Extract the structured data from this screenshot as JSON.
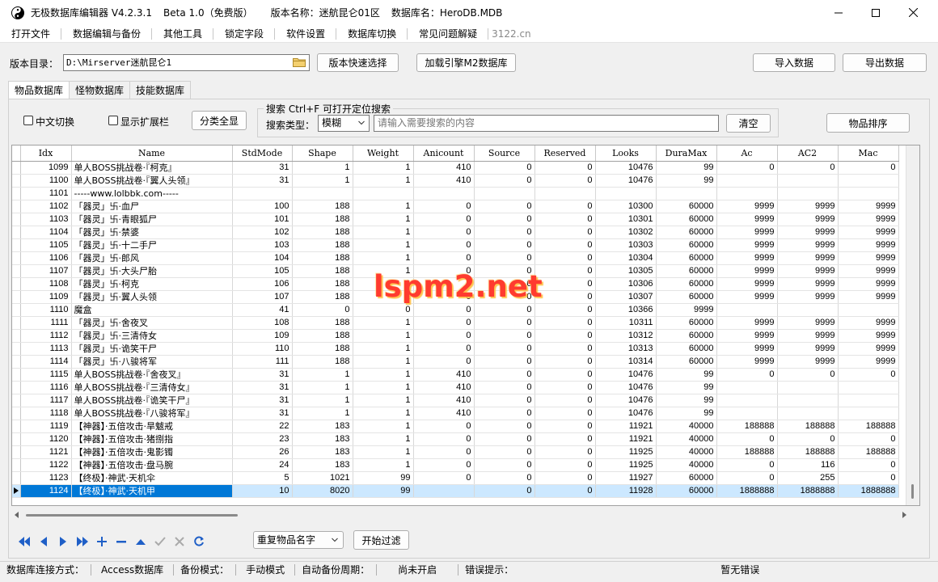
{
  "titlebar": {
    "app_name": "无极数据库编辑器 V4.2.3.1",
    "beta": "Beta 1.0（免费版）",
    "version_name": "版本名称：迷航昆仑01区",
    "database_name": "数据库名：HeroDB.MDB"
  },
  "menu": {
    "items": [
      "打开文件",
      "数据编辑与备份",
      "其他工具",
      "锁定字段",
      "软件设置",
      "数据库切换",
      "常见问题解疑"
    ],
    "site": "3122.cn"
  },
  "toolbar": {
    "dir_label": "版本目录：",
    "dir_value": "D:\\Mirserver迷航昆仑1",
    "quick_select": "版本快速选择",
    "load_engine": "加载引擎M2数据库",
    "import": "导入数据",
    "export": "导出数据"
  },
  "tabs": [
    "物品数据库",
    "怪物数据库",
    "技能数据库"
  ],
  "filters": {
    "chinese_toggle": "中文切换",
    "show_ext": "显示扩展栏",
    "show_all": "分类全显",
    "search_title": "搜索  Ctrl+F 可打开定位搜索",
    "search_type_label": "搜索类型：",
    "search_type_value": "模糊",
    "search_placeholder": "请输入需要搜索的内容",
    "clear": "清空",
    "sort": "物品排序"
  },
  "grid": {
    "columns": [
      "Idx",
      "Name",
      "StdMode",
      "Shape",
      "Weight",
      "Anicount",
      "Source",
      "Reserved",
      "Looks",
      "DuraMax",
      "Ac",
      "AC2",
      "Mac"
    ],
    "rows": [
      [
        "1099",
        "单人BOSS挑战卷·『柯克』",
        "31",
        "1",
        "1",
        "410",
        "0",
        "0",
        "10476",
        "99",
        "0",
        "0",
        "0"
      ],
      [
        "1100",
        "单人BOSS挑战卷·『翼人头领』",
        "31",
        "1",
        "1",
        "410",
        "0",
        "0",
        "10476",
        "99",
        "",
        "",
        ""
      ],
      [
        "1101",
        "-----www.lolbbk.com-----",
        "",
        "",
        "",
        "",
        "",
        "",
        "",
        "",
        "",
        "",
        ""
      ],
      [
        "1102",
        "「器灵」卐·血尸",
        "100",
        "188",
        "1",
        "0",
        "0",
        "0",
        "10300",
        "60000",
        "9999",
        "9999",
        "9999"
      ],
      [
        "1103",
        "「器灵」卐·青眼狐尸",
        "101",
        "188",
        "1",
        "0",
        "0",
        "0",
        "10301",
        "60000",
        "9999",
        "9999",
        "9999"
      ],
      [
        "1104",
        "「器灵」卐·禁婆",
        "102",
        "188",
        "1",
        "0",
        "0",
        "0",
        "10302",
        "60000",
        "9999",
        "9999",
        "9999"
      ],
      [
        "1105",
        "「器灵」卐·十二手尸",
        "103",
        "188",
        "1",
        "0",
        "0",
        "0",
        "10303",
        "60000",
        "9999",
        "9999",
        "9999"
      ],
      [
        "1106",
        "「器灵」卐·郎风",
        "104",
        "188",
        "1",
        "0",
        "0",
        "0",
        "10304",
        "60000",
        "9999",
        "9999",
        "9999"
      ],
      [
        "1107",
        "「器灵」卐·大头尸胎",
        "105",
        "188",
        "1",
        "0",
        "0",
        "0",
        "10305",
        "60000",
        "9999",
        "9999",
        "9999"
      ],
      [
        "1108",
        "「器灵」卐·柯克",
        "106",
        "188",
        "1",
        "0",
        "0",
        "0",
        "10306",
        "60000",
        "9999",
        "9999",
        "9999"
      ],
      [
        "1109",
        "「器灵」卐·翼人头领",
        "107",
        "188",
        "1",
        "0",
        "0",
        "0",
        "10307",
        "60000",
        "9999",
        "9999",
        "9999"
      ],
      [
        "1110",
        "魔盒",
        "41",
        "0",
        "0",
        "0",
        "0",
        "0",
        "10366",
        "9999",
        "",
        "",
        ""
      ],
      [
        "1111",
        "「器灵」卐·舍夜叉",
        "108",
        "188",
        "1",
        "0",
        "0",
        "0",
        "10311",
        "60000",
        "9999",
        "9999",
        "9999"
      ],
      [
        "1112",
        "「器灵」卐·三清侍女",
        "109",
        "188",
        "1",
        "0",
        "0",
        "0",
        "10312",
        "60000",
        "9999",
        "9999",
        "9999"
      ],
      [
        "1113",
        "「器灵」卐·诡笑干尸",
        "110",
        "188",
        "1",
        "0",
        "0",
        "0",
        "10313",
        "60000",
        "9999",
        "9999",
        "9999"
      ],
      [
        "1114",
        "「器灵」卐·八骏将军",
        "111",
        "188",
        "1",
        "0",
        "0",
        "0",
        "10314",
        "60000",
        "9999",
        "9999",
        "9999"
      ],
      [
        "1115",
        "单人BOSS挑战卷·『舍夜叉』",
        "31",
        "1",
        "1",
        "410",
        "0",
        "0",
        "10476",
        "99",
        "0",
        "0",
        "0"
      ],
      [
        "1116",
        "单人BOSS挑战卷·『三清侍女』",
        "31",
        "1",
        "1",
        "410",
        "0",
        "0",
        "10476",
        "99",
        "",
        "",
        ""
      ],
      [
        "1117",
        "单人BOSS挑战卷·『诡笑干尸』",
        "31",
        "1",
        "1",
        "410",
        "0",
        "0",
        "10476",
        "99",
        "",
        "",
        ""
      ],
      [
        "1118",
        "单人BOSS挑战卷·『八骏将军』",
        "31",
        "1",
        "1",
        "410",
        "0",
        "0",
        "10476",
        "99",
        "",
        "",
        ""
      ],
      [
        "1119",
        "【神器】·五倍攻击·旱魃戒",
        "22",
        "183",
        "1",
        "0",
        "0",
        "0",
        "11921",
        "40000",
        "188888",
        "188888",
        "188888"
      ],
      [
        "1120",
        "【神器】·五倍攻击·猪捌指",
        "23",
        "183",
        "1",
        "0",
        "0",
        "0",
        "11921",
        "40000",
        "0",
        "0",
        "0"
      ],
      [
        "1121",
        "【神器】·五倍攻击·鬼影镯",
        "26",
        "183",
        "1",
        "0",
        "0",
        "0",
        "11925",
        "40000",
        "188888",
        "188888",
        "188888"
      ],
      [
        "1122",
        "【神器】·五倍攻击·盘马腕",
        "24",
        "183",
        "1",
        "0",
        "0",
        "0",
        "11925",
        "40000",
        "0",
        "116",
        "0"
      ],
      [
        "1123",
        "【终极】·神武·天机伞",
        "5",
        "1021",
        "99",
        "0",
        "0",
        "0",
        "11927",
        "60000",
        "0",
        "255",
        "0"
      ],
      [
        "1124",
        "【终极】·神武·天机甲",
        "10",
        "8020",
        "99",
        "",
        "0",
        "0",
        "11928",
        "60000",
        "1888888",
        "1888888",
        "1888888"
      ]
    ],
    "selected_index": 25
  },
  "bottom": {
    "dup_select": "重复物品名字",
    "start_filter": "开始过滤"
  },
  "status": {
    "conn_label": "数据库连接方式：",
    "conn_value": "Access数据库",
    "backup_label": "备份模式：",
    "backup_value": "手动模式",
    "auto_backup_label": "自动备份周期：",
    "auto_backup_value": "尚未开启",
    "error_label": "错误提示：",
    "error_value": "暂无错误"
  },
  "watermark": "lspm2.net"
}
